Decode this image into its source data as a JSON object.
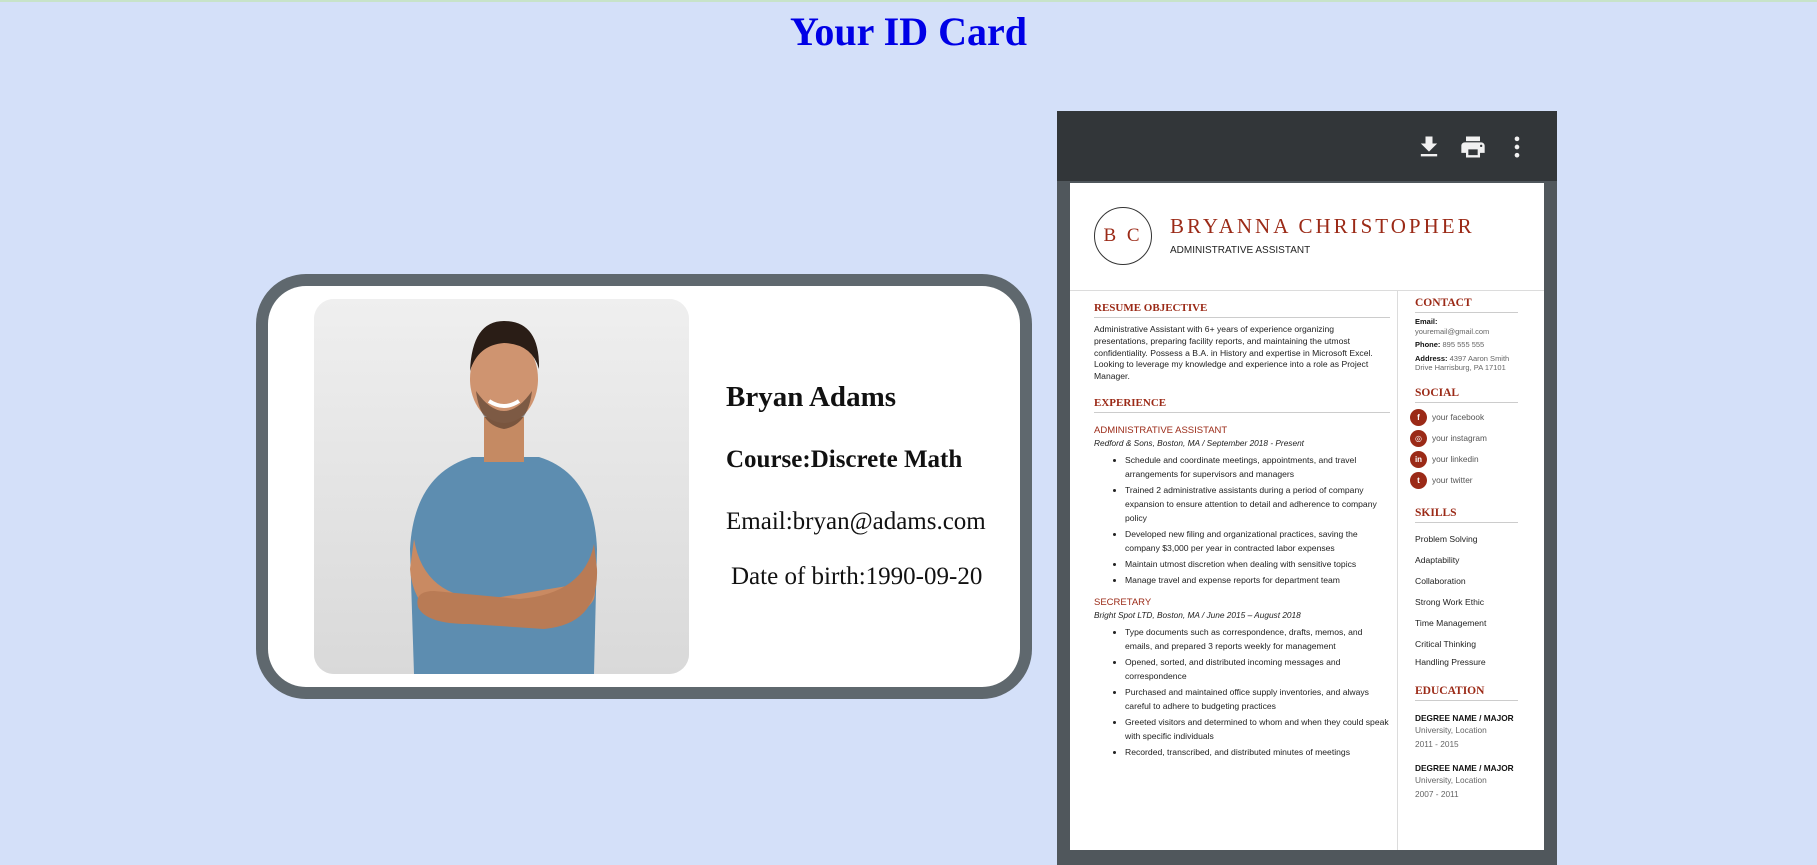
{
  "page": {
    "title": "Your ID Card"
  },
  "id_card": {
    "name": "Bryan Adams",
    "course": "Course:Discrete Math",
    "email": "Email:bryan@adams.com",
    "dob": "Date of birth:1990-09-20"
  },
  "viewer": {
    "toolbar": {
      "download_icon": "download-icon",
      "print_icon": "print-icon",
      "more_icon": "more-vertical-icon"
    }
  },
  "resume": {
    "monogram": "B C",
    "name": "BRYANNA CHRISTOPHER",
    "role": "ADMINISTRATIVE ASSISTANT",
    "objective_head": "RESUME OBJECTIVE",
    "objective": "Administrative Assistant with 6+ years of experience organizing presentations, preparing facility reports, and maintaining the utmost confidentiality. Possess a B.A. in History and expertise in Microsoft Excel. Looking to leverage my knowledge and experience into a role as Project Manager.",
    "experience_head": "EXPERIENCE",
    "jobs": [
      {
        "title": "ADMINISTRATIVE ASSISTANT",
        "meta": "Redford & Sons, Boston, MA  /  September 2018 - Present",
        "bullets": [
          "Schedule and coordinate meetings, appointments, and travel arrangements for supervisors and managers",
          "Trained 2 administrative assistants during a period of company expansion to ensure attention to detail and adherence to company policy",
          "Developed new filing and organizational practices, saving the company $3,000 per year in contracted labor expenses",
          "Maintain utmost discretion when dealing with sensitive topics",
          "Manage travel and expense reports for department team"
        ]
      },
      {
        "title": "SECRETARY",
        "meta": "Bright Spot LTD, Boston, MA  /  June 2015 – August 2018",
        "bullets": [
          "Type documents such as correspondence, drafts, memos, and emails, and prepared 3 reports weekly for management",
          "Opened, sorted, and distributed incoming messages and correspondence",
          "Purchased and maintained office supply inventories, and always careful to adhere to budgeting practices",
          "Greeted visitors and determined to whom and when they could speak with specific individuals",
          "Recorded, transcribed, and distributed minutes of meetings"
        ]
      }
    ],
    "contact_head": "CONTACT",
    "contact": {
      "email_label": "Email:",
      "email": "youremail@gmail.com",
      "phone_label": "Phone:",
      "phone": "895 555 555",
      "address_label": "Address:",
      "address": "4397 Aaron Smith Drive Harrisburg, PA 17101"
    },
    "social_head": "SOCIAL",
    "social": [
      {
        "icon": "facebook-icon",
        "glyph": "f",
        "label": "your facebook"
      },
      {
        "icon": "instagram-icon",
        "glyph": "◎",
        "label": "your instagram"
      },
      {
        "icon": "linkedin-icon",
        "glyph": "in",
        "label": "your linkedin"
      },
      {
        "icon": "twitter-icon",
        "glyph": "t",
        "label": "your twitter"
      }
    ],
    "skills_head": "SKILLS",
    "skills": [
      "Problem Solving",
      "Adaptability",
      "Collaboration",
      "Strong Work Ethic",
      "Time Management",
      "Critical Thinking",
      "Handling Pressure"
    ],
    "education_head": "EDUCATION",
    "education": [
      {
        "degree": "DEGREE NAME / MAJOR",
        "school": "University, Location",
        "years": "2011 - 2015"
      },
      {
        "degree": "DEGREE NAME / MAJOR",
        "school": "University, Location",
        "years": "2007 - 2011"
      }
    ]
  },
  "colors": {
    "page_bg": "#d4e0f9",
    "title": "#0000e6",
    "card_border": "#5f686e",
    "accent": "#9b2a17",
    "toolbar": "#323639"
  }
}
